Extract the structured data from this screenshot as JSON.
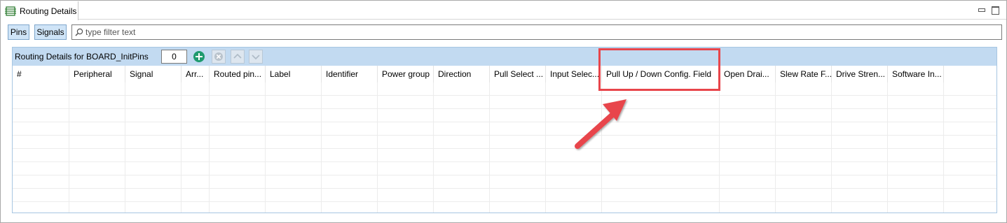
{
  "view": {
    "tab_title": "Routing Details",
    "tab_icon": "routing-details-icon"
  },
  "toolbar": {
    "pins_label": "Pins",
    "signals_label": "Signals",
    "filter_placeholder": "type filter text"
  },
  "panel": {
    "title": "Routing Details for BOARD_InitPins",
    "count_value": "0",
    "header_bg": "#c2daf1"
  },
  "table": {
    "columns": [
      "#",
      "Peripheral",
      "Signal",
      "Arr...",
      "Routed pin...",
      "Label",
      "Identifier",
      "Power group",
      "Direction",
      "Pull Select ...",
      "Input Selec...",
      "Pull Up / Down Config. Field",
      "Open Drai...",
      "Slew Rate F...",
      "Drive Stren...",
      "Software In..."
    ]
  },
  "annotation": {
    "highlight_color": "#e8454b",
    "target_column": "Pull Up / Down Config. Field"
  }
}
